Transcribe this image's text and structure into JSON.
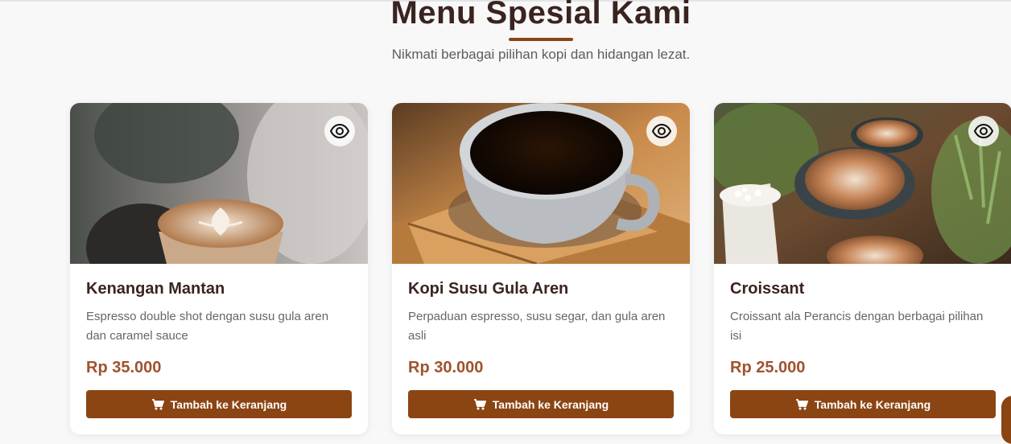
{
  "section": {
    "title": "Menu Spesial Kami",
    "subtitle": "Nikmati berbagai pilihan kopi dan hidangan lezat."
  },
  "colors": {
    "accent": "#8b4513",
    "price": "#a0522d",
    "title": "#3a2420"
  },
  "icons": {
    "view": "eye-icon",
    "cart": "cart-icon"
  },
  "cards": [
    {
      "name": "Kenangan Mantan",
      "description": "Espresso double shot dengan susu gula aren dan caramel sauce",
      "price": "Rp 35.000",
      "button_label": "Tambah ke Keranjang",
      "image": "latte-art-glass-photo"
    },
    {
      "name": "Kopi Susu Gula Aren",
      "description": "Perpaduan espresso, susu segar, dan gula aren asli",
      "price": "Rp 30.000",
      "button_label": "Tambah ke Keranjang",
      "image": "black-coffee-cup-photo"
    },
    {
      "name": "Croissant",
      "description": "Croissant ala Perancis dengan berbagai pilihan isi",
      "price": "Rp 25.000",
      "button_label": "Tambah ke Keranjang",
      "image": "cappuccinos-and-plants-photo"
    }
  ]
}
